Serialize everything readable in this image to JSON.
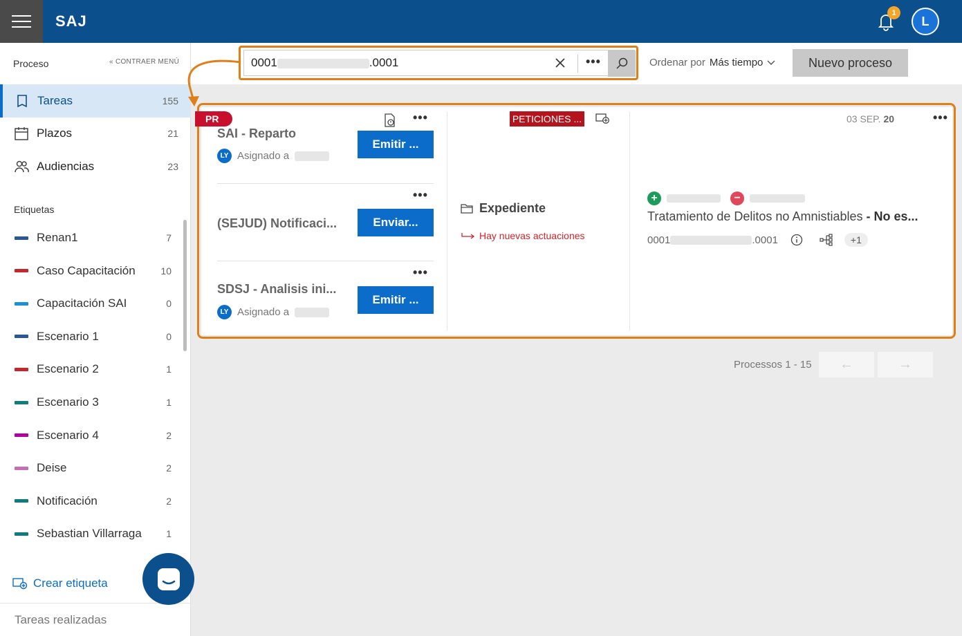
{
  "app": {
    "title": "SAJ",
    "notifications_count": "1",
    "user_initial": "L"
  },
  "sidebar": {
    "section_title": "Proceso",
    "collapse_label": "CONTRAER MENÚ",
    "nav": [
      {
        "label": "Tareas",
        "count": "155"
      },
      {
        "label": "Plazos",
        "count": "21"
      },
      {
        "label": "Audiencias",
        "count": "23"
      }
    ],
    "tags_title": "Etiquetas",
    "tags": [
      {
        "label": "Renan1",
        "count": "7",
        "color": "#2b579a"
      },
      {
        "label": "Caso Capacitación",
        "count": "10",
        "color": "#c4262e"
      },
      {
        "label": "Capacitación SAI",
        "count": "0",
        "color": "#1a8fd8"
      },
      {
        "label": "Escenario 1",
        "count": "0",
        "color": "#2b579a"
      },
      {
        "label": "Escenario 2",
        "count": "1",
        "color": "#c4262e"
      },
      {
        "label": "Escenario 3",
        "count": "1",
        "color": "#107c7c"
      },
      {
        "label": "Escenario 4",
        "count": "2",
        "color": "#b4009e"
      },
      {
        "label": "Deise",
        "count": "2",
        "color": "#c36fb2"
      },
      {
        "label": "Notificación",
        "count": "2",
        "color": "#107c7c"
      },
      {
        "label": "Sebastian Villarraga",
        "count": "1",
        "color": "#107c7c"
      }
    ],
    "create_tag_label": "Crear etiqueta",
    "done_tasks_label": "Tareas realizadas"
  },
  "toolbar": {
    "search_prefix": "0001",
    "search_suffix": ".0001",
    "sort_label": "Ordenar por",
    "sort_value": "Más tiempo",
    "new_process_label": "Nuevo proceso"
  },
  "card": {
    "badge": "PR",
    "tasks": [
      {
        "title": "SAI - Reparto",
        "assign_label": "Asignado a",
        "avatar": "LY",
        "button": "Emitir ..."
      },
      {
        "title": "(SEJUD) Notificaci...",
        "button": "Enviar..."
      },
      {
        "title": "SDSJ - Analisis ini...",
        "assign_label": "Asignado a",
        "avatar": "LY",
        "button": "Emitir ..."
      }
    ],
    "peticiones_badge": "PETICIONES ...",
    "expediente_label": "Expediente",
    "news_label": "Hay nuevas actuaciones",
    "date_prefix": "03 SEP.",
    "date_year": "20",
    "subject_text": "Tratamiento de Delitos no Amnistiables",
    "subject_bold": " - No es...",
    "number_prefix": "0001",
    "number_suffix": ".0001",
    "extra_count": "+1"
  },
  "pager": {
    "label": "Processos 1 - 15"
  },
  "colors": {
    "primary": "#0b4f8c",
    "accent": "#0b6dc9",
    "highlight": "#e07f17",
    "danger": "#c8102e"
  }
}
